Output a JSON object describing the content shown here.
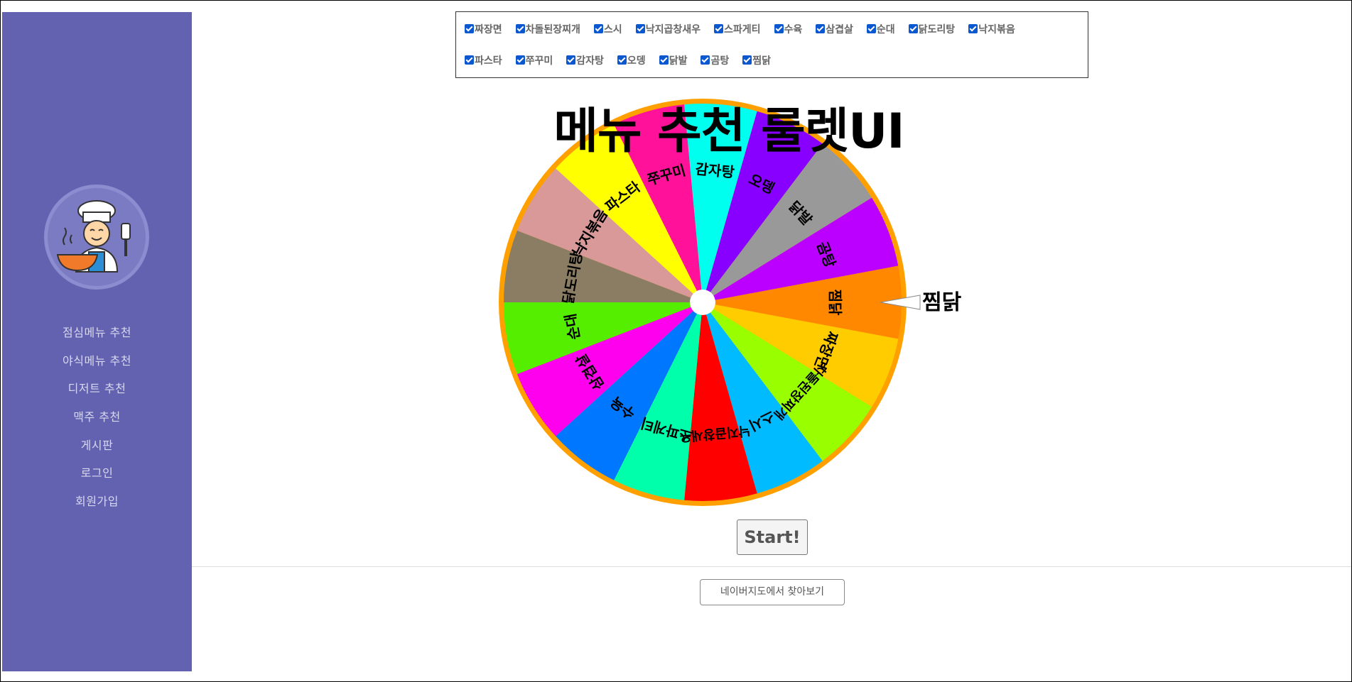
{
  "sidebar": {
    "nav": [
      {
        "label": "점심메뉴 추천"
      },
      {
        "label": "야식메뉴 추천"
      },
      {
        "label": "디저트 추천"
      },
      {
        "label": "맥주 추천"
      },
      {
        "label": "게시판"
      },
      {
        "label": "로그인"
      },
      {
        "label": "회원가입"
      }
    ],
    "bg_color": "#6262b1"
  },
  "menu_options": [
    {
      "label": "짜장면",
      "checked": true
    },
    {
      "label": "차돌된장찌개",
      "checked": true
    },
    {
      "label": "스시",
      "checked": true
    },
    {
      "label": "낙지곱창새우",
      "checked": true
    },
    {
      "label": "스파게티",
      "checked": true
    },
    {
      "label": "수육",
      "checked": true
    },
    {
      "label": "삼겹살",
      "checked": true
    },
    {
      "label": "순대",
      "checked": true
    },
    {
      "label": "닭도리탕",
      "checked": true
    },
    {
      "label": "낙지볶음",
      "checked": true
    },
    {
      "label": "파스타",
      "checked": true
    },
    {
      "label": "쭈꾸미",
      "checked": true
    },
    {
      "label": "감자탕",
      "checked": true
    },
    {
      "label": "오뎅",
      "checked": true
    },
    {
      "label": "닭발",
      "checked": true
    },
    {
      "label": "곰탕",
      "checked": true
    },
    {
      "label": "찜닭",
      "checked": true
    }
  ],
  "title": "메뉴 추천 룰렛UI",
  "wheel": {
    "segments": [
      {
        "label": "찜닭",
        "color": "#ff8800"
      },
      {
        "label": "짜장면",
        "color": "#ffcc00"
      },
      {
        "label": "차돌된장찌개",
        "color": "#99ff00"
      },
      {
        "label": "스시",
        "color": "#00bbff"
      },
      {
        "label": "낙지곱창새우",
        "color": "#ff0000"
      },
      {
        "label": "스파게티",
        "color": "#00ffaa"
      },
      {
        "label": "수육",
        "color": "#0077ff"
      },
      {
        "label": "삼겹살",
        "color": "#ff00ee"
      },
      {
        "label": "순대",
        "color": "#55ee00"
      },
      {
        "label": "닭도리탕",
        "color": "#8b7d64"
      },
      {
        "label": "낙지볶음",
        "color": "#d99999"
      },
      {
        "label": "파스타",
        "color": "#ffff00"
      },
      {
        "label": "쭈꾸미",
        "color": "#ff1199"
      },
      {
        "label": "감자탕",
        "color": "#00ffee"
      },
      {
        "label": "오뎅",
        "color": "#8800ff"
      },
      {
        "label": "닭발",
        "color": "#999999"
      },
      {
        "label": "곰탕",
        "color": "#bb00ff"
      }
    ],
    "rim_color": "#ffa000",
    "selected": "찜닭"
  },
  "start_label": "Start!",
  "map_button_label": "네이버지도에서 찾아보기"
}
